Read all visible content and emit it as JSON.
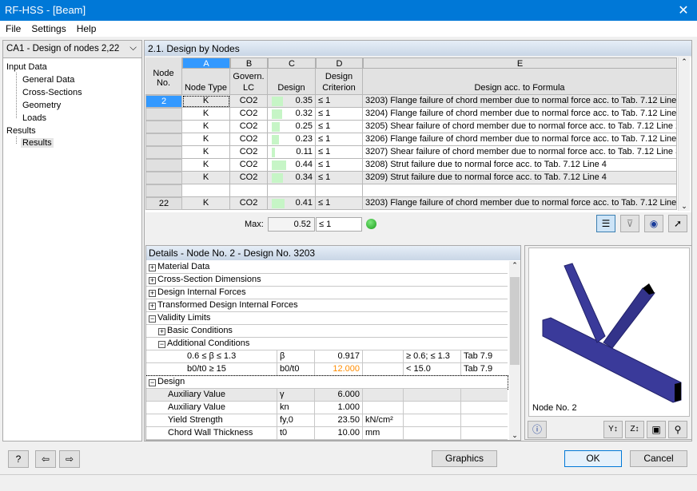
{
  "window": {
    "title": "RF-HSS - [Beam]",
    "close": "✕"
  },
  "menu": [
    "File",
    "Settings",
    "Help"
  ],
  "nav": {
    "case": "CA1 - Design of nodes 2,22",
    "items": [
      {
        "label": "Input Data",
        "level": 0
      },
      {
        "label": "General Data",
        "level": 1
      },
      {
        "label": "Cross-Sections",
        "level": 1
      },
      {
        "label": "Geometry",
        "level": 1
      },
      {
        "label": "Loads",
        "level": 1
      },
      {
        "label": "Results",
        "level": 0
      },
      {
        "label": "Results",
        "level": 1
      }
    ]
  },
  "table": {
    "title": "2.1. Design by Nodes",
    "letters": [
      "A",
      "B",
      "C",
      "D",
      "E"
    ],
    "headers": {
      "node": "Node No.",
      "a": "Node Type",
      "b": "Govern. LC",
      "c": "Design",
      "d": "Design Criterion",
      "e": "Design acc. to Formula"
    },
    "rows": [
      {
        "node": "2",
        "type": "K",
        "lc": "CO2",
        "design": "0.35",
        "crit": "≤ 1",
        "formula": "3203) Flange failure of chord member due to normal force acc. to Tab. 7.12 Line 1"
      },
      {
        "node": "",
        "type": "K",
        "lc": "CO2",
        "design": "0.32",
        "crit": "≤ 1",
        "formula": "3204) Flange failure of chord member due to normal force acc. to Tab. 7.12 Line 1"
      },
      {
        "node": "",
        "type": "K",
        "lc": "CO2",
        "design": "0.25",
        "crit": "≤ 1",
        "formula": "3205) Shear failure of chord member due to normal force acc. to Tab. 7.12 Line 2"
      },
      {
        "node": "",
        "type": "K",
        "lc": "CO2",
        "design": "0.23",
        "crit": "≤ 1",
        "formula": "3206) Flange failure of chord member due to normal force acc. to Tab. 7.12 Line 2"
      },
      {
        "node": "",
        "type": "K",
        "lc": "CO2",
        "design": "0.11",
        "crit": "≤ 1",
        "formula": "3207) Shear failure of chord member due to normal force acc. to Tab. 7.12 Line 3"
      },
      {
        "node": "",
        "type": "K",
        "lc": "CO2",
        "design": "0.44",
        "crit": "≤ 1",
        "formula": "3208) Strut failure due to normal force acc. to Tab. 7.12 Line 4"
      },
      {
        "node": "",
        "type": "K",
        "lc": "CO2",
        "design": "0.34",
        "crit": "≤ 1",
        "formula": "3209) Strut failure due to normal force acc. to Tab. 7.12 Line 4"
      },
      {
        "node": "",
        "type": "",
        "lc": "",
        "design": "",
        "crit": "",
        "formula": ""
      },
      {
        "node": "22",
        "type": "K",
        "lc": "CO2",
        "design": "0.41",
        "crit": "≤ 1",
        "formula": "3203) Flange failure of chord member due to normal force acc. to Tab. 7.12 Line 1"
      }
    ],
    "max_label": "Max:",
    "max_value": "0.52",
    "max_crit": "≤ 1",
    "status": "ok"
  },
  "details": {
    "title": "Details - Node No. 2 - Design No. 3203",
    "rows": [
      {
        "indent": 0,
        "toggle": "+",
        "label": "Material Data"
      },
      {
        "indent": 0,
        "toggle": "+",
        "label": "Cross-Section Dimensions"
      },
      {
        "indent": 0,
        "toggle": "+",
        "label": "Design Internal Forces"
      },
      {
        "indent": 0,
        "toggle": "+",
        "label": "Transformed Design Internal Forces"
      },
      {
        "indent": 0,
        "toggle": "−",
        "label": "Validity Limits"
      },
      {
        "indent": 1,
        "toggle": "+",
        "label": "Basic Conditions"
      },
      {
        "indent": 1,
        "toggle": "−",
        "label": "Additional Conditions"
      },
      {
        "indent": 2,
        "label": "0.6 ≤ β ≤ 1.3",
        "sym": "β",
        "val": "0.917",
        "unit": "",
        "limit": "≥ 0.6; ≤ 1.3",
        "ref": "Tab 7.9"
      },
      {
        "indent": 2,
        "label": "b0/t0 ≥ 15",
        "sym": "b0/t0",
        "val": "12.000",
        "warn": true,
        "unit": "",
        "limit": "< 15.0",
        "ref": "Tab 7.9"
      },
      {
        "indent": 0,
        "toggle": "−",
        "label": "Design"
      },
      {
        "indent": 1,
        "label": "Auxiliary Value",
        "sym": "γ",
        "val": "6.000",
        "unit": "",
        "limit": "",
        "ref": ""
      },
      {
        "indent": 1,
        "label": "Auxiliary Value",
        "sym": "kn",
        "val": "1.000",
        "unit": "",
        "limit": "",
        "ref": ""
      },
      {
        "indent": 1,
        "label": "Yield Strength",
        "sym": "fy,0",
        "val": "23.50",
        "unit": "kN/cm²",
        "limit": "",
        "ref": ""
      },
      {
        "indent": 1,
        "label": "Chord Wall Thickness",
        "sym": "t0",
        "val": "10.00",
        "unit": "mm",
        "limit": "",
        "ref": ""
      }
    ]
  },
  "graphic": {
    "caption": "Node No. 2",
    "member_color": "#3a3a9a"
  },
  "buttons": {
    "graphics": "Graphics",
    "ok": "OK",
    "cancel": "Cancel"
  },
  "colors": {
    "accent": "#0078d7",
    "selection": "#3399ff",
    "bar": "#c6f5c6",
    "warn": "#ff8c00"
  }
}
